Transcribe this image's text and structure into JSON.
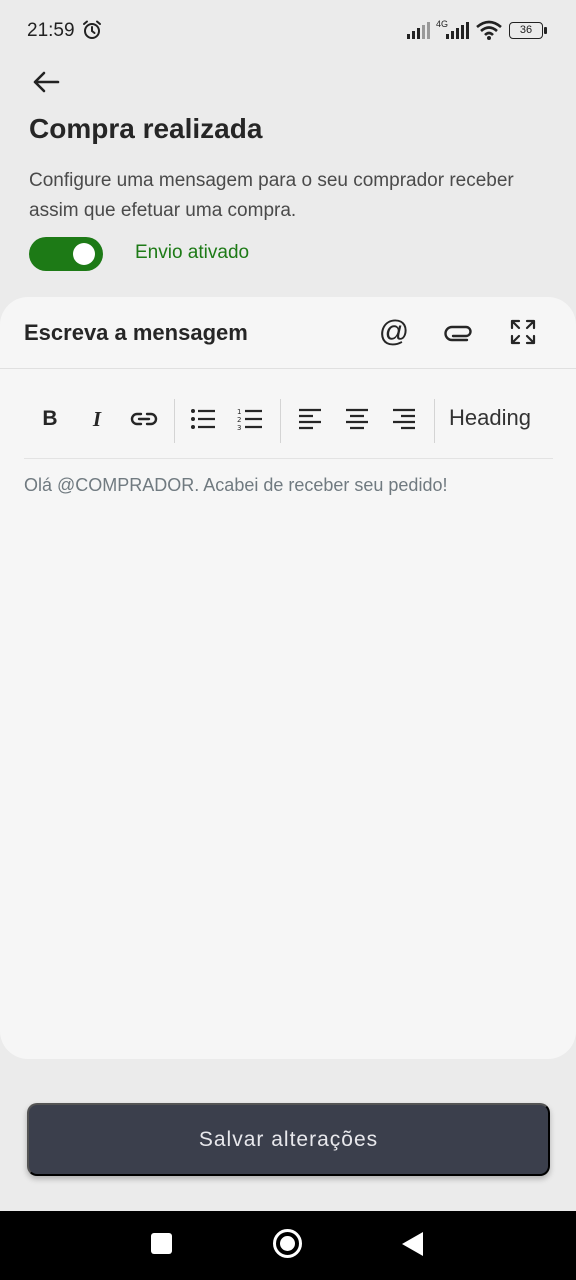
{
  "status_bar": {
    "time": "21:59",
    "network": "4G",
    "battery": "36",
    "icons": [
      "alarm-icon",
      "signal-icon",
      "wifi-icon",
      "battery-icon"
    ]
  },
  "header": {
    "back_icon": "arrow-left-icon",
    "title": "Compra realizada",
    "description": "Configure uma mensagem para o seu comprador receber assim que efetuar uma compra."
  },
  "toggle": {
    "enabled": true,
    "label": "Envio ativado",
    "accent_color": "#1d7a16"
  },
  "editor": {
    "title": "Escreva a mensagem",
    "header_icons": [
      "at-icon",
      "paperclip-icon",
      "expand-icon"
    ],
    "at_symbol": "@",
    "toolbar": {
      "bold": "B",
      "italic": "I",
      "heading": "Heading",
      "icons": [
        "bold-icon",
        "italic-icon",
        "link-icon",
        "bullet-list-icon",
        "numbered-list-icon",
        "align-left-icon",
        "align-center-icon",
        "align-right-icon"
      ]
    },
    "content": "Olá @COMPRADOR. Acabei de receber seu pedido!"
  },
  "actions": {
    "save_label": "Salvar alterações",
    "button_color": "#3b3f4c"
  },
  "nav_bar": {
    "icons": [
      "recents-icon",
      "home-icon",
      "back-icon"
    ]
  }
}
